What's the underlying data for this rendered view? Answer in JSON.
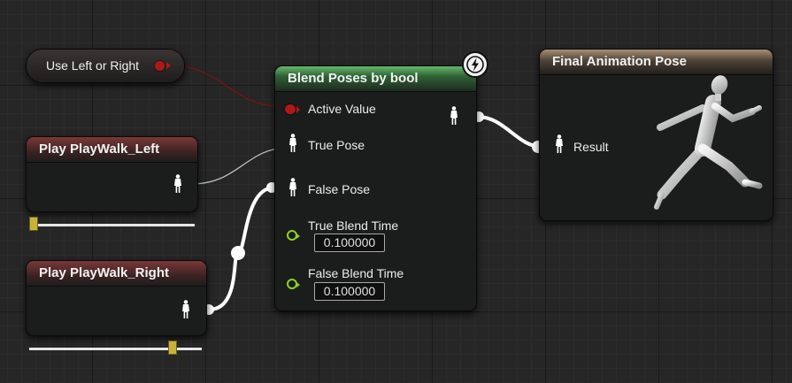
{
  "canvas": {
    "background": "#262626"
  },
  "nodes": {
    "use_left_or_right": {
      "label": "Use Left or Right",
      "pin_color": "#b01818"
    },
    "play_walk_left": {
      "title": "Play PlayWalk_Left",
      "header_color": "#7a3838",
      "slider_value": 0.0
    },
    "play_walk_right": {
      "title": "Play PlayWalk_Right",
      "header_color": "#7a3838",
      "slider_value": 0.85
    },
    "blend_poses": {
      "title": "Blend Poses by bool",
      "header_color": "#66b86e",
      "pins": {
        "active_value": "Active Value",
        "true_pose": "True Pose",
        "false_pose": "False Pose",
        "true_blend_time": "True Blend Time",
        "true_blend_time_value": "0.100000",
        "false_blend_time": "False Blend Time",
        "false_blend_time_value": "0.100000"
      },
      "badge_icon": "lightning-bolt-icon"
    },
    "final_pose": {
      "title": "Final Animation Pose",
      "header_color": "#a88e76",
      "pins": {
        "result": "Result"
      },
      "preview_icon": "running-mannequin-icon"
    }
  },
  "colors": {
    "pose_pin": "#ffffff",
    "bool_pin": "#b01818",
    "float_pin": "#8cd321"
  }
}
